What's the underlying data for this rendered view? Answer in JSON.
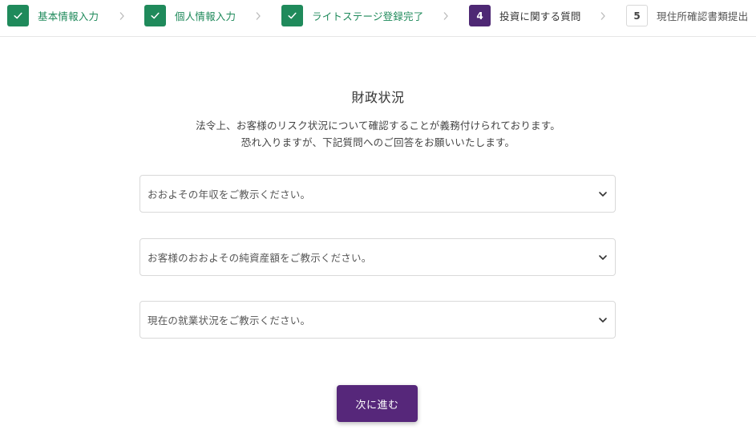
{
  "colors": {
    "done": "#1f8a5b",
    "active": "#4e2874",
    "button": "#56277a"
  },
  "stepper": {
    "steps": [
      {
        "label": "基本情報入力",
        "state": "done",
        "icon": "check-icon"
      },
      {
        "label": "個人情報入力",
        "state": "done",
        "icon": "check-icon"
      },
      {
        "label": "ライトステージ登録完了",
        "state": "done",
        "icon": "check-icon"
      },
      {
        "number": "4",
        "label": "投資に関する質問",
        "state": "active"
      },
      {
        "number": "5",
        "label": "現住所確認書類提出",
        "state": "pending"
      }
    ],
    "separator_icon": "chevron-right-icon"
  },
  "main": {
    "title": "財政状況",
    "description_line1": "法令上、お客様のリスク状況について確認することが義務付けられております。",
    "description_line2": "恐れ入りますが、下記質問へのご回答をお願いいたします。",
    "selects": [
      {
        "placeholder": "おおよその年収をご教示ください。"
      },
      {
        "placeholder": "お客様のおおよその純資産額をご教示ください。"
      },
      {
        "placeholder": "現在の就業状況をご教示ください。"
      }
    ],
    "next_button": "次に進む"
  }
}
